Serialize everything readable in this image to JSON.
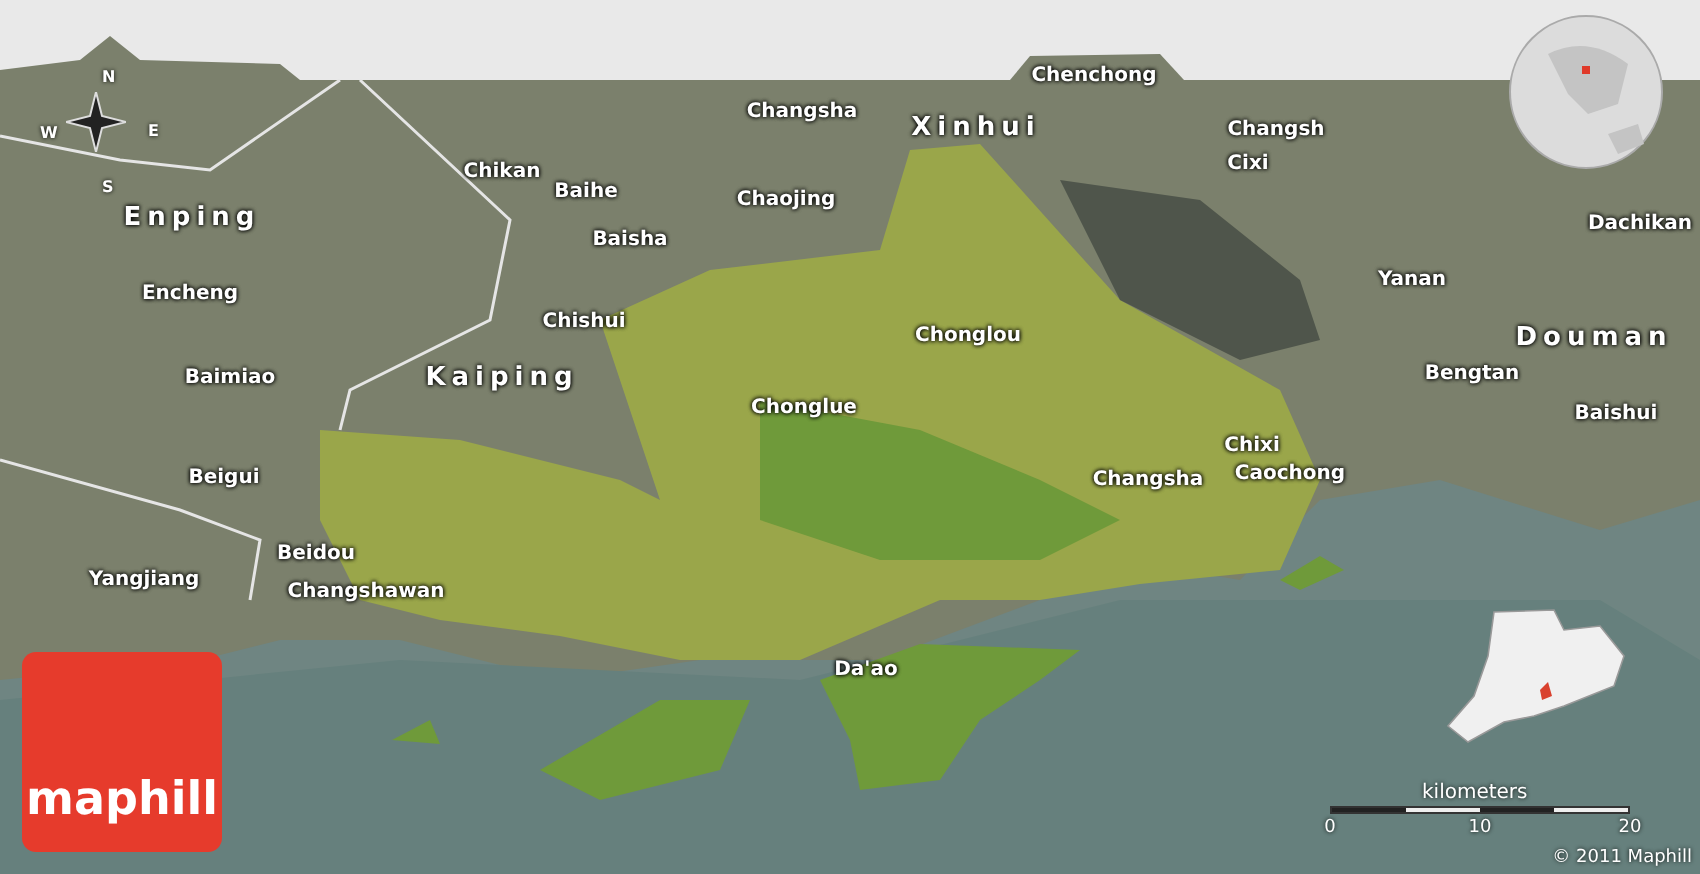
{
  "map": {
    "labels": [
      {
        "text": "Chenchong",
        "kind": "town"
      },
      {
        "text": "Changsha",
        "kind": "town"
      },
      {
        "text": "Xinhui",
        "kind": "region"
      },
      {
        "text": "Changsh",
        "kind": "town"
      },
      {
        "text": "Cixi",
        "kind": "town"
      },
      {
        "text": "Chikan",
        "kind": "town"
      },
      {
        "text": "Baihe",
        "kind": "town"
      },
      {
        "text": "Chaojing",
        "kind": "town"
      },
      {
        "text": "Enping",
        "kind": "region"
      },
      {
        "text": "Baisha",
        "kind": "town"
      },
      {
        "text": "Dachikan",
        "kind": "town"
      },
      {
        "text": "Yanan",
        "kind": "town"
      },
      {
        "text": "Encheng",
        "kind": "town"
      },
      {
        "text": "Chishui",
        "kind": "town"
      },
      {
        "text": "Chonglou",
        "kind": "town"
      },
      {
        "text": "Douman",
        "kind": "region"
      },
      {
        "text": "Baimiao",
        "kind": "town"
      },
      {
        "text": "Kaiping",
        "kind": "region"
      },
      {
        "text": "Bengtan",
        "kind": "town"
      },
      {
        "text": "Chonglue",
        "kind": "town"
      },
      {
        "text": "Baishui",
        "kind": "town"
      },
      {
        "text": "Chixi",
        "kind": "town"
      },
      {
        "text": "Beigui",
        "kind": "town"
      },
      {
        "text": "Changsha",
        "kind": "town"
      },
      {
        "text": "Caochong",
        "kind": "town"
      },
      {
        "text": "Beidou",
        "kind": "town"
      },
      {
        "text": "Yangjiang",
        "kind": "town"
      },
      {
        "text": "Changshawan",
        "kind": "town"
      },
      {
        "text": "Da'ao",
        "kind": "town"
      }
    ],
    "compass": [
      "N",
      "E",
      "S",
      "W"
    ],
    "scale": {
      "unit": "kilometers",
      "ticks": [
        "0",
        "10",
        "20"
      ]
    },
    "logo": "maphill",
    "copyright": "© 2011 Maphill"
  }
}
